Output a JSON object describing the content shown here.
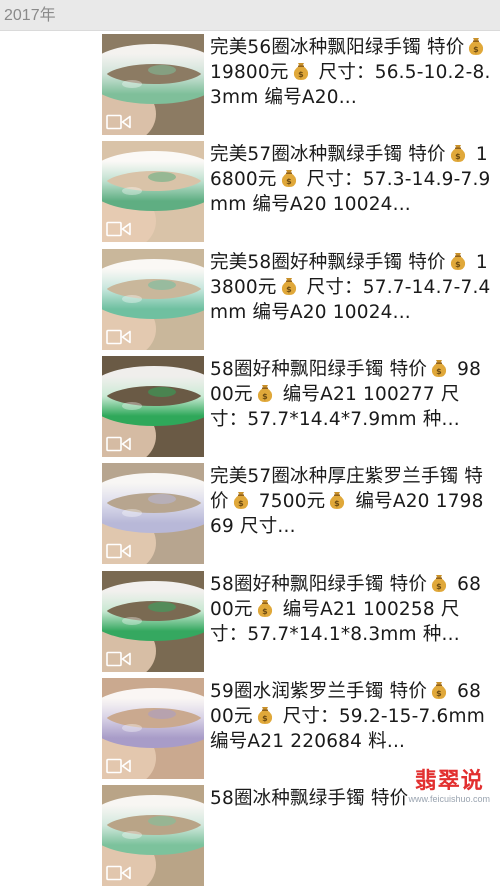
{
  "header": {
    "year": "2017年"
  },
  "items": [
    {
      "type": "video",
      "segments": [
        "完美56圈冰种飘阳绿手镯 特价",
        "bag",
        " 19800元",
        "bag",
        " 尺寸：56.5-10.2-8.3mm 编号A20..."
      ],
      "photo": {
        "bg": "#8c7b63",
        "band": "#cfe3d8",
        "fleck": "#7fbf9a"
      }
    },
    {
      "type": "video",
      "segments": [
        "完美57圈冰种飘绿手镯 特价",
        "bag",
        " 16800元",
        "bag",
        " 尺寸：57.3-14.9-7.9mm 编号A20 10024..."
      ],
      "photo": {
        "bg": "#d9c3a8",
        "band": "#bfe0cf",
        "fleck": "#5fae82"
      }
    },
    {
      "type": "video",
      "segments": [
        "完美58圈好种飘绿手镯 特价",
        "bag",
        " 13800元",
        "bag",
        " 尺寸：57.7-14.7-7.4mm 编号A20 10024..."
      ],
      "photo": {
        "bg": "#c9b79b",
        "band": "#c6e6dc",
        "fleck": "#6fc0a0"
      }
    },
    {
      "type": "video",
      "segments": [
        "58圈好种飘阳绿手镯 特价",
        "bag",
        " 9800元",
        "bag",
        " 编号A21 100277 尺寸：57.7*14.4*7.9mm 种..."
      ],
      "photo": {
        "bg": "#6a5a45",
        "band": "#cbead5",
        "fleck": "#2fa85a"
      }
    },
    {
      "type": "video",
      "segments": [
        "完美57圈冰种厚庄紫罗兰手镯 特价",
        "bag",
        " 7500元",
        "bag",
        " 编号A20 179869 尺寸..."
      ],
      "photo": {
        "bg": "#b7a58f",
        "band": "#dcdcec",
        "fleck": "#b8b8d8"
      }
    },
    {
      "type": "video",
      "segments": [
        "58圈好种飘阳绿手镯 特价",
        "bag",
        " 6800元",
        "bag",
        " 编号A21 100258 尺寸：57.7*14.1*8.3mm 种..."
      ],
      "photo": {
        "bg": "#7a6a52",
        "band": "#c8e8d2",
        "fleck": "#35a860"
      }
    },
    {
      "type": "video",
      "segments": [
        "59圈水润紫罗兰手镯 特价",
        "bag",
        " 6800元",
        "bag",
        " 尺寸：59.2-15-7.6mm 编号A21 220684 料..."
      ],
      "photo": {
        "bg": "#caa98f",
        "band": "#d8d2e6",
        "fleck": "#a89cc8"
      }
    },
    {
      "type": "video",
      "segments": [
        "58圈冰种飘绿手镯 特价"
      ],
      "photo": {
        "bg": "#b9a487",
        "band": "#d2e8dd",
        "fleck": "#7cc29c"
      }
    }
  ],
  "watermark": {
    "brand": "翡翠说",
    "url": "www.feicuishuo.com"
  },
  "colors": {
    "year_bar_bg": "#e9e9e9",
    "year_text": "#8a8a8a",
    "watermark_brand": "#e23030"
  },
  "icons": {
    "media_type": "video-camera-icon",
    "price_marker": "money-bag-icon"
  }
}
